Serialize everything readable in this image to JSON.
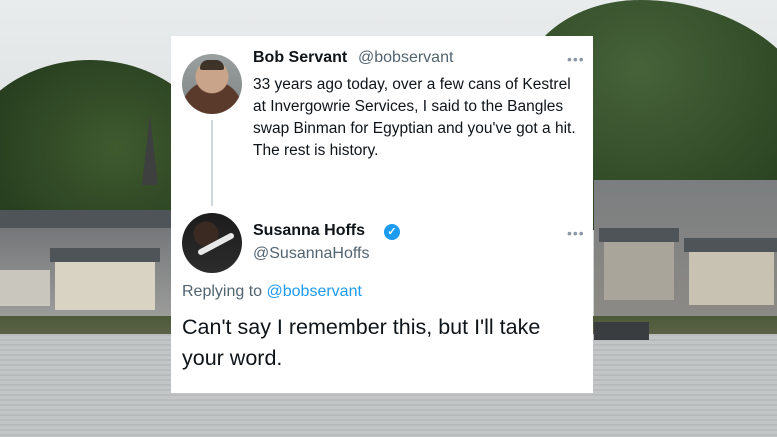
{
  "tweet_original": {
    "author_name": "Bob Servant",
    "author_handle": "@bobservant",
    "text": "33 years ago today, over a few cans of Kestrel at Invergowrie Services, I said to the Bangles swap Binman for Egyptian and you've got a hit. The rest is history.",
    "more_icon": "ellipsis-icon"
  },
  "tweet_reply": {
    "author_name": "Susanna Hoffs",
    "author_handle": "@SusannaHoffs",
    "verified_icon": "verified-badge-icon",
    "replying_prefix": "Replying to",
    "replying_to": "@bobservant",
    "text": "Can't say I remember this, but I'll take your word.",
    "more_icon": "ellipsis-icon"
  },
  "colors": {
    "link": "#1d9bf0",
    "secondary_text": "#536471",
    "primary_text": "#0f1419"
  }
}
